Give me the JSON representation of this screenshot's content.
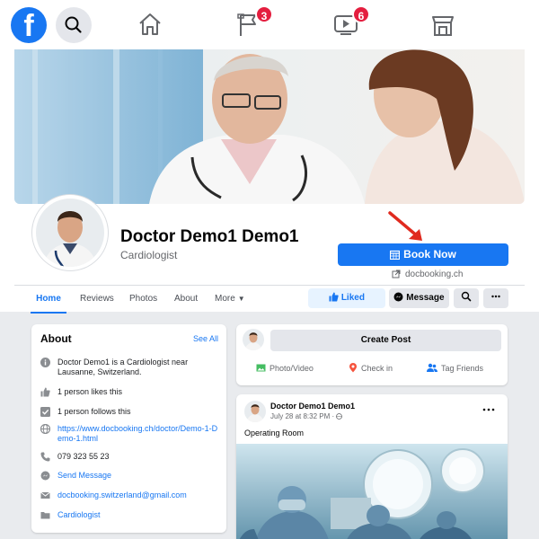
{
  "topnav": {
    "logo_letter": "f",
    "notifications": {
      "flag_badge": "3",
      "watch_badge": "6"
    },
    "icons": [
      "facebook-logo",
      "search-icon",
      "home-icon",
      "flag-icon",
      "watch-icon",
      "marketplace-icon"
    ]
  },
  "profile": {
    "name": "Doctor Demo1 Demo1",
    "category": "Cardiologist",
    "book_button": "Book Now",
    "book_link": "docbooking.ch"
  },
  "tabs": [
    "Home",
    "Reviews",
    "Photos",
    "About",
    "More"
  ],
  "actions": {
    "liked": "Liked",
    "message": "Message"
  },
  "about": {
    "title": "About",
    "see_all": "See All",
    "rows": [
      {
        "icon": "info-icon",
        "text": "Doctor Demo1 is a Cardiologist near Lausanne, Switzerland."
      },
      {
        "icon": "thumbs-up-icon",
        "text": "1 person likes this"
      },
      {
        "icon": "checkbox-icon",
        "text": "1 person follows this"
      },
      {
        "icon": "globe-icon",
        "text": "https://www.docbooking.ch/doctor/Demo-1-Demo-1.html"
      },
      {
        "icon": "phone-icon",
        "text": "079 323 55 23"
      },
      {
        "icon": "messenger-icon",
        "text": "Send Message"
      },
      {
        "icon": "email-icon",
        "text": "docbooking.switzerland@gmail.com"
      },
      {
        "icon": "folder-icon",
        "text": "Cardiologist"
      }
    ]
  },
  "create_post": {
    "button": "Create Post",
    "options": [
      "Photo/Video",
      "Check in",
      "Tag Friends"
    ]
  },
  "post": {
    "author": "Doctor Demo1 Demo1",
    "time": "July 28 at 8:32 PM · ",
    "text": "Operating Room"
  },
  "colors": {
    "brand_blue": "#1877f2",
    "badge_red": "#e41e3f",
    "background": "#e9ebee"
  }
}
